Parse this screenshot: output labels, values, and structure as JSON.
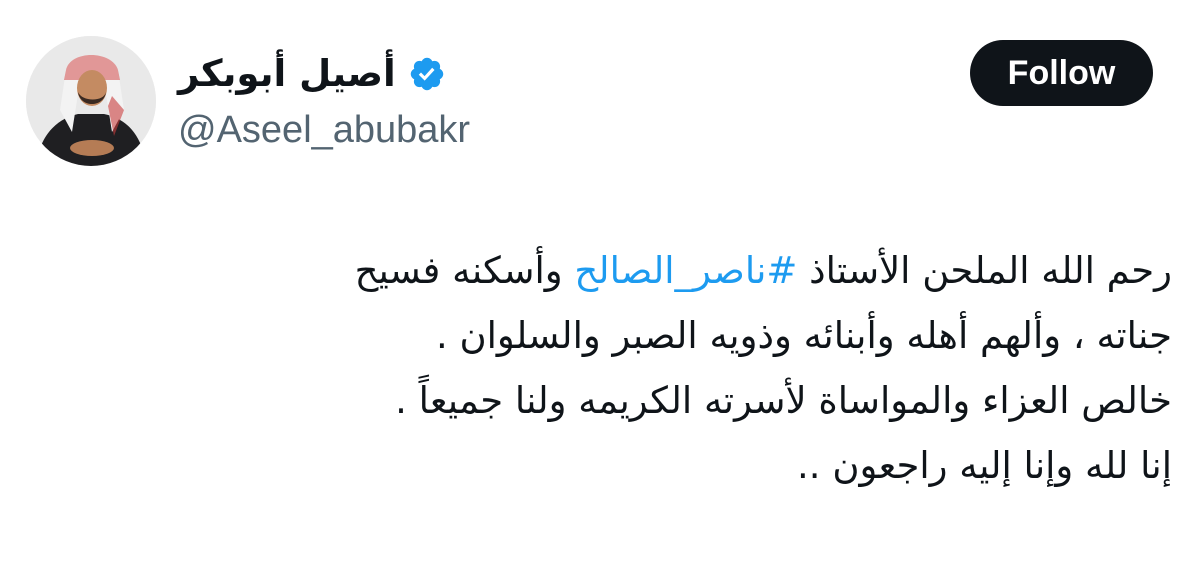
{
  "author": {
    "display_name": "أصيل أبوبكر",
    "handle": "@Aseel_abubakr",
    "verified_icon": "verified-badge-icon",
    "verified_color": "#1d9bf0"
  },
  "follow_button": {
    "label": "Follow"
  },
  "tweet": {
    "line1_before": "رحم الله الملحن الأستاذ ",
    "hashtag": "#ناصر_الصالح",
    "line1_after": " وأسكنه فسيح",
    "line2": "جناته ، وألهم أهله وأبنائه وذويه الصبر والسلوان .",
    "line3": "خالص العزاء والمواساة لأسرته الكريمه ولنا جميعاً .",
    "line4": "إنا لله وإنا إليه راجعون .."
  },
  "colors": {
    "text": "#0f1419",
    "secondary_text": "#536471",
    "link": "#1d9bf0",
    "button_bg": "#0f1419",
    "button_text": "#ffffff"
  }
}
